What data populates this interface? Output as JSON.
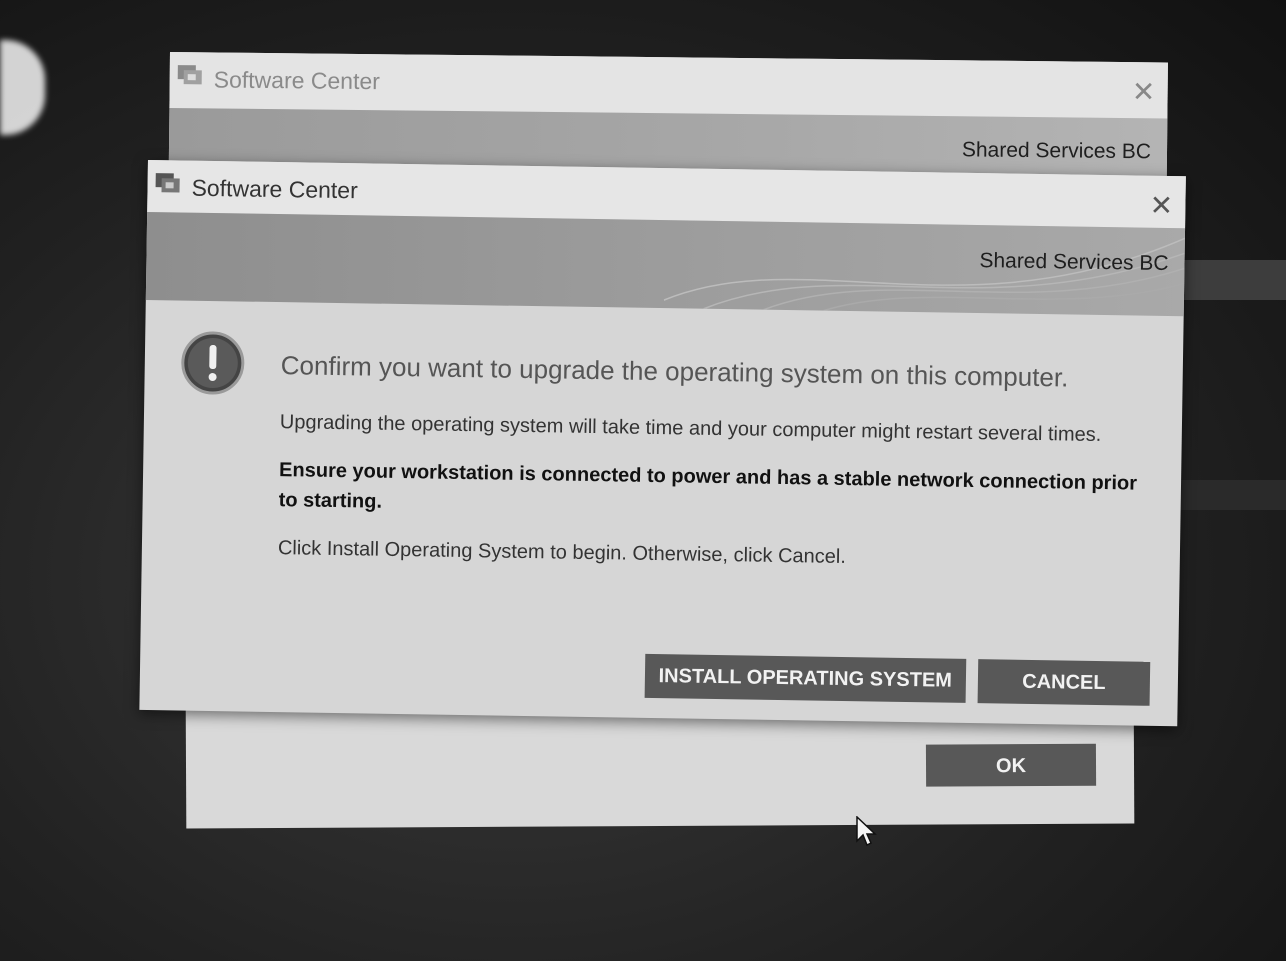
{
  "back_dialog": {
    "title": "Software Center",
    "org_name": "Shared Services BC",
    "close_glyph": "✕",
    "ok_label": "OK"
  },
  "main_dialog": {
    "title": "Software Center",
    "org_name": "Shared Services BC",
    "close_glyph": "✕",
    "icon": "warning-exclamation-icon",
    "heading": "Confirm you want to upgrade the operating system on this computer.",
    "paragraph_1": "Upgrading the operating system will take time and your computer might restart several times.",
    "paragraph_2_bold": "Ensure your workstation is connected to power and has a stable network connection prior to starting.",
    "paragraph_3": "Click Install Operating System to begin. Otherwise, click Cancel.",
    "install_label": "INSTALL OPERATING SYSTEM",
    "cancel_label": "CANCEL"
  },
  "colors": {
    "button_bg": "#585858",
    "banner_bg": "#9c9c9c",
    "dialog_bg": "#d6d6d6"
  }
}
